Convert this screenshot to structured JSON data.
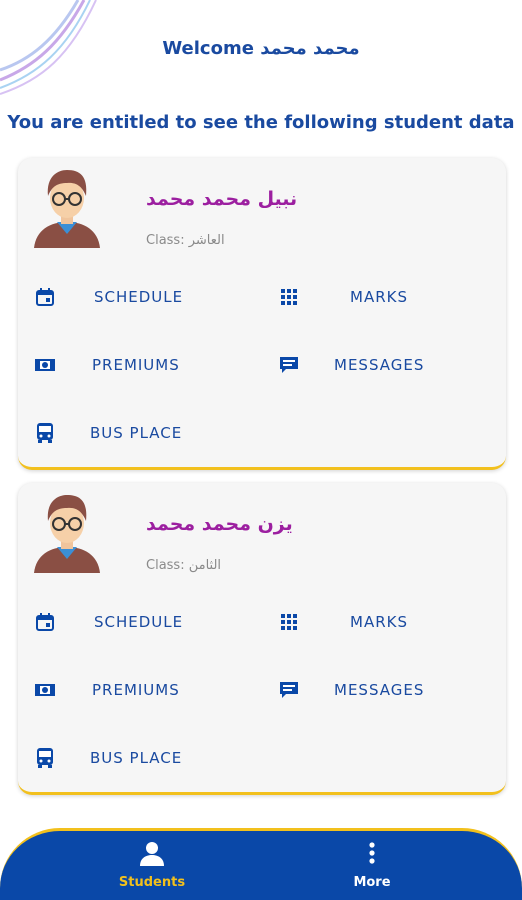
{
  "header": {
    "welcome": "Welcome محمد محمد",
    "subtitle": "You are entitled to see the following student data"
  },
  "students": [
    {
      "name": "نبيل محمد محمد",
      "class_text": "Class: العاشر",
      "actions": {
        "schedule": "SCHEDULE",
        "marks": "MARKS",
        "premiums": "PREMIUMS",
        "messages": "MESSAGES",
        "bus_place": "BUS PLACE"
      }
    },
    {
      "name": "يزن محمد محمد",
      "class_text": "Class: الثامن",
      "actions": {
        "schedule": "SCHEDULE",
        "marks": "MARKS",
        "premiums": "PREMIUMS",
        "messages": "MESSAGES",
        "bus_place": "BUS PLACE"
      }
    }
  ],
  "bottom_nav": {
    "students": "Students",
    "more": "More"
  },
  "colors": {
    "primary": "#0a48a8",
    "accent": "#f2c01d",
    "name": "#9c1fa0"
  }
}
